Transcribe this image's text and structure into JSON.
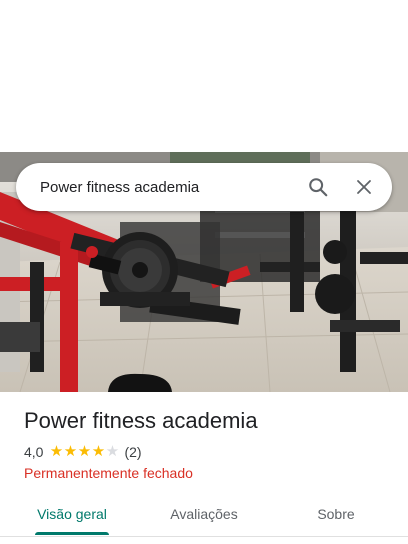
{
  "search": {
    "query": "Power fitness academia"
  },
  "place": {
    "name": "Power fitness academia",
    "rating_value": "4,0",
    "rating_stars": 4,
    "rating_count": "(2)",
    "status": "Permanentemente fechado"
  },
  "tabs": [
    {
      "label": "Visão geral",
      "active": true
    },
    {
      "label": "Avaliações",
      "active": false
    },
    {
      "label": "Sobre",
      "active": false
    }
  ],
  "colors": {
    "accent": "#00796b",
    "status_closed": "#d93025",
    "star": "#fbbc04"
  },
  "icons": {
    "search": "search-icon",
    "close": "close-icon"
  }
}
